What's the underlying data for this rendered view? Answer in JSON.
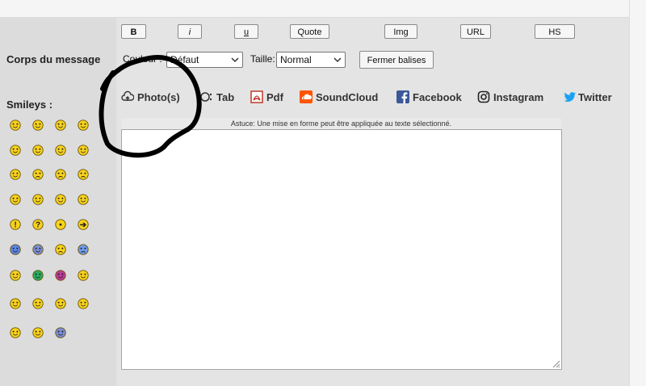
{
  "toolbar": {
    "buttons": [
      {
        "label": "B"
      },
      {
        "label": "i"
      },
      {
        "label": "u"
      },
      {
        "label": "Quote"
      },
      {
        "label": "Img"
      },
      {
        "label": "URL"
      },
      {
        "label": "HS"
      }
    ],
    "close_tags_label": "Fermer balises"
  },
  "form": {
    "message_label": "Corps du message",
    "smileys_label": "Smileys :",
    "color_label": "Couleur :",
    "color_value": "Défaut",
    "size_label": "Taille:",
    "size_value": "Normal"
  },
  "embed": [
    {
      "label": "Photo(s)",
      "icon": "cloud-upload-icon"
    },
    {
      "label": "Tab",
      "icon": "tab-icon"
    },
    {
      "label": "Pdf",
      "icon": "pdf-icon"
    },
    {
      "label": "SoundCloud",
      "icon": "soundcloud-icon"
    },
    {
      "label": "Facebook",
      "icon": "facebook-icon"
    },
    {
      "label": "Instagram",
      "icon": "instagram-icon"
    },
    {
      "label": "Twitter",
      "icon": "twitter-icon"
    }
  ],
  "hint": "Astuce: Une mise en forme peut être appliquée au texte sélectionné.",
  "smileys": [
    [
      "smile",
      "grin",
      "happy",
      "laugh"
    ],
    [
      "wink",
      "cool",
      "nerd",
      "glasses"
    ],
    [
      "neutral",
      "worried",
      "sad",
      "confused"
    ],
    [
      "angry",
      "mad",
      "devil",
      "evil"
    ],
    [
      "exclamation",
      "question",
      "idea",
      "arrow"
    ],
    [
      "blue-grin",
      "blue-shock",
      "sorry",
      "cry"
    ],
    [
      "yellow-teeth",
      "green-teeth",
      "pink-teeth",
      "yellow-grin"
    ],
    [
      "rolling-eyes",
      "surprised",
      "hug",
      "guitar"
    ],
    [
      "singing",
      "whistling",
      "thumbs-up"
    ]
  ],
  "colors": {
    "page": "#ededed",
    "panel": "#e4e4e4",
    "sidebar": "#dcdcdc",
    "pdf": "#c0392b",
    "soundcloud": "#ff5500",
    "facebook": "#3b5998",
    "twitter": "#1da1f2",
    "annotation": "#000000"
  }
}
